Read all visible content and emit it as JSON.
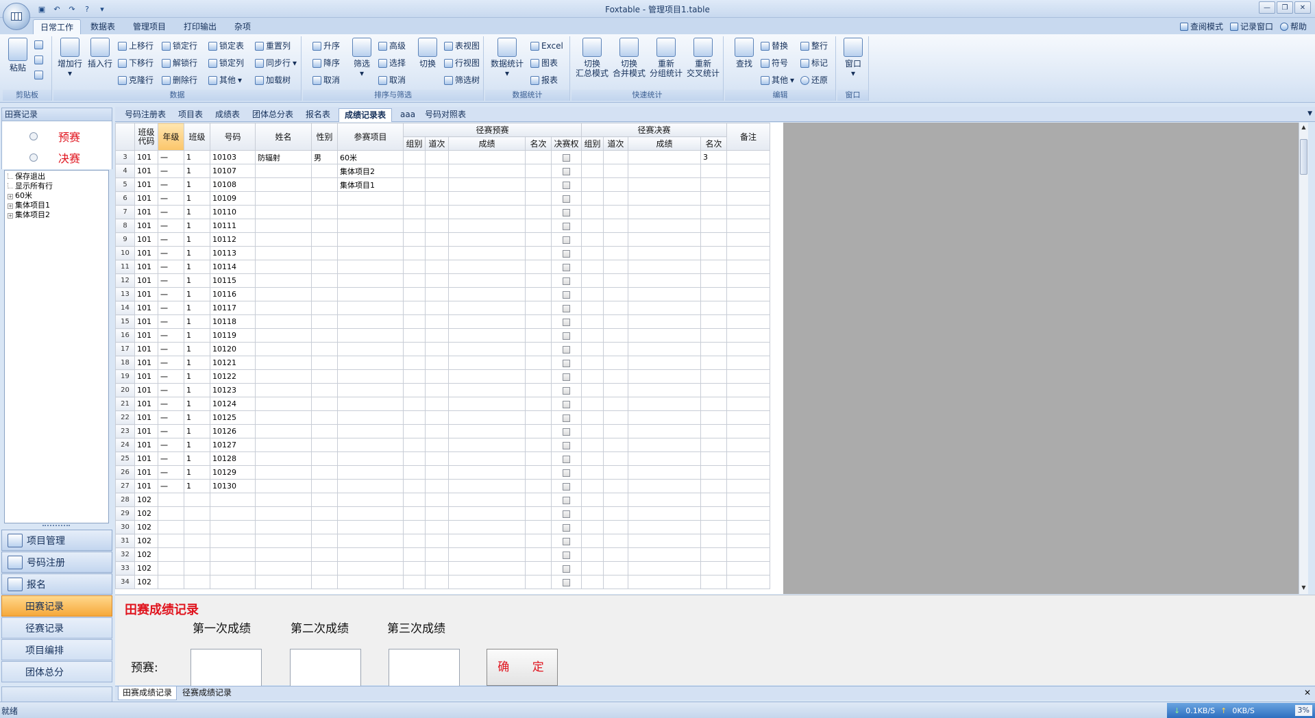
{
  "window": {
    "title": "Foxtable - 管理项目1.table"
  },
  "ribbon_tabs": [
    "日常工作",
    "数据表",
    "管理项目",
    "打印输出",
    "杂项"
  ],
  "right_links": [
    "查阅模式",
    "记录窗口",
    "帮助"
  ],
  "ribbon": {
    "clipboard": {
      "title": "剪贴板",
      "paste": "粘贴"
    },
    "data": {
      "title": "数据",
      "add_row": "增加行",
      "insert_row": "插入行",
      "items": [
        "上移行",
        "锁定行",
        "锁定表",
        "重置列",
        "下移行",
        "解锁行",
        "锁定列",
        "同步行",
        "克隆行",
        "删除行",
        "其他",
        "加载树"
      ]
    },
    "sort": {
      "title": "排序与筛选",
      "asc": "升序",
      "desc": "降序",
      "cancel": "取消",
      "filter": "筛选",
      "advanced": "高级",
      "select": "选择",
      "cancel2": "取消",
      "switch": "切换"
    },
    "view": {
      "table_view": "表视图",
      "row_view": "行视图",
      "filter_tree": "筛选树"
    },
    "stats": {
      "title": "数据统计",
      "data_stats": "数据统计",
      "excel": "Excel",
      "chart": "图表",
      "report": "报表"
    },
    "quick": {
      "title": "快速统计",
      "btns": [
        [
          "切换",
          "汇总模式"
        ],
        [
          "切换",
          "合并模式"
        ],
        [
          "重新",
          "分组统计"
        ],
        [
          "重新",
          "交叉统计"
        ]
      ]
    },
    "edit": {
      "title": "编辑",
      "find": "查找",
      "replace": "替换",
      "symbol": "符号",
      "other": "其他",
      "tidy": "整行",
      "mark": "标记",
      "restore": "还原"
    },
    "window": {
      "title": "窗口",
      "window": "窗口"
    }
  },
  "left_panel": {
    "header": "田赛记录",
    "radios": [
      "预赛",
      "决赛"
    ],
    "tree": [
      {
        "label": "保存退出",
        "expand": false
      },
      {
        "label": "显示所有行",
        "expand": false
      },
      {
        "label": "60米",
        "expand": true
      },
      {
        "label": "集体项目1",
        "expand": true
      },
      {
        "label": "集体项目2",
        "expand": true
      }
    ],
    "nav": [
      "项目管理",
      "号码注册",
      "报名"
    ],
    "sub_items": [
      "田赛记录",
      "径赛记录",
      "项目编排",
      "团体总分"
    ]
  },
  "main_tabs": [
    "号码注册表",
    "项目表",
    "成绩表",
    "团体总分表",
    "报名表",
    "成绩记录表",
    "aaa",
    "号码对照表"
  ],
  "grid": {
    "headers": {
      "class_code": "班级代码",
      "grade": "年级",
      "class": "班级",
      "number": "号码",
      "name": "姓名",
      "gender": "性别",
      "event": "参赛项目",
      "prelim": "径赛预赛",
      "final": "径赛决赛",
      "group": "组别",
      "lane": "道次",
      "score": "成绩",
      "rank": "名次",
      "qualify": "决赛权",
      "remark": "备注"
    },
    "rows": [
      {
        "n": "3",
        "code": "101",
        "grade": "一",
        "cls": "1",
        "num": "10103",
        "name": "防辐射",
        "gender": "男",
        "event": "60米",
        "frank": "3"
      },
      {
        "n": "4",
        "code": "101",
        "grade": "一",
        "cls": "1",
        "num": "10107",
        "event": "集体项目2"
      },
      {
        "n": "5",
        "code": "101",
        "grade": "一",
        "cls": "1",
        "num": "10108",
        "event": "集体项目1"
      },
      {
        "n": "6",
        "code": "101",
        "grade": "一",
        "cls": "1",
        "num": "10109"
      },
      {
        "n": "7",
        "code": "101",
        "grade": "一",
        "cls": "1",
        "num": "10110"
      },
      {
        "n": "8",
        "code": "101",
        "grade": "一",
        "cls": "1",
        "num": "10111"
      },
      {
        "n": "9",
        "code": "101",
        "grade": "一",
        "cls": "1",
        "num": "10112"
      },
      {
        "n": "10",
        "code": "101",
        "grade": "一",
        "cls": "1",
        "num": "10113"
      },
      {
        "n": "11",
        "code": "101",
        "grade": "一",
        "cls": "1",
        "num": "10114"
      },
      {
        "n": "12",
        "code": "101",
        "grade": "一",
        "cls": "1",
        "num": "10115"
      },
      {
        "n": "13",
        "code": "101",
        "grade": "一",
        "cls": "1",
        "num": "10116"
      },
      {
        "n": "14",
        "code": "101",
        "grade": "一",
        "cls": "1",
        "num": "10117"
      },
      {
        "n": "15",
        "code": "101",
        "grade": "一",
        "cls": "1",
        "num": "10118"
      },
      {
        "n": "16",
        "code": "101",
        "grade": "一",
        "cls": "1",
        "num": "10119"
      },
      {
        "n": "17",
        "code": "101",
        "grade": "一",
        "cls": "1",
        "num": "10120"
      },
      {
        "n": "18",
        "code": "101",
        "grade": "一",
        "cls": "1",
        "num": "10121"
      },
      {
        "n": "19",
        "code": "101",
        "grade": "一",
        "cls": "1",
        "num": "10122"
      },
      {
        "n": "20",
        "code": "101",
        "grade": "一",
        "cls": "1",
        "num": "10123"
      },
      {
        "n": "21",
        "code": "101",
        "grade": "一",
        "cls": "1",
        "num": "10124"
      },
      {
        "n": "22",
        "code": "101",
        "grade": "一",
        "cls": "1",
        "num": "10125"
      },
      {
        "n": "23",
        "code": "101",
        "grade": "一",
        "cls": "1",
        "num": "10126"
      },
      {
        "n": "24",
        "code": "101",
        "grade": "一",
        "cls": "1",
        "num": "10127"
      },
      {
        "n": "25",
        "code": "101",
        "grade": "一",
        "cls": "1",
        "num": "10128"
      },
      {
        "n": "26",
        "code": "101",
        "grade": "一",
        "cls": "1",
        "num": "10129"
      },
      {
        "n": "27",
        "code": "101",
        "grade": "一",
        "cls": "1",
        "num": "10130"
      },
      {
        "n": "28",
        "code": "102"
      },
      {
        "n": "29",
        "code": "102"
      },
      {
        "n": "30",
        "code": "102"
      },
      {
        "n": "31",
        "code": "102"
      },
      {
        "n": "32",
        "code": "102"
      },
      {
        "n": "33",
        "code": "102"
      },
      {
        "n": "34",
        "code": "102"
      }
    ]
  },
  "form": {
    "title": "田赛成绩记录",
    "col_labels": [
      "第一次成绩",
      "第二次成绩",
      "第三次成绩"
    ],
    "row_label": "预赛:",
    "ok": "确 定"
  },
  "bottom_tabs": [
    "田赛成绩记录",
    "径赛成绩记录"
  ],
  "status": {
    "text": "就绪",
    "down": "0.1KB/S",
    "up": "0KB/S",
    "pct": "3%"
  }
}
